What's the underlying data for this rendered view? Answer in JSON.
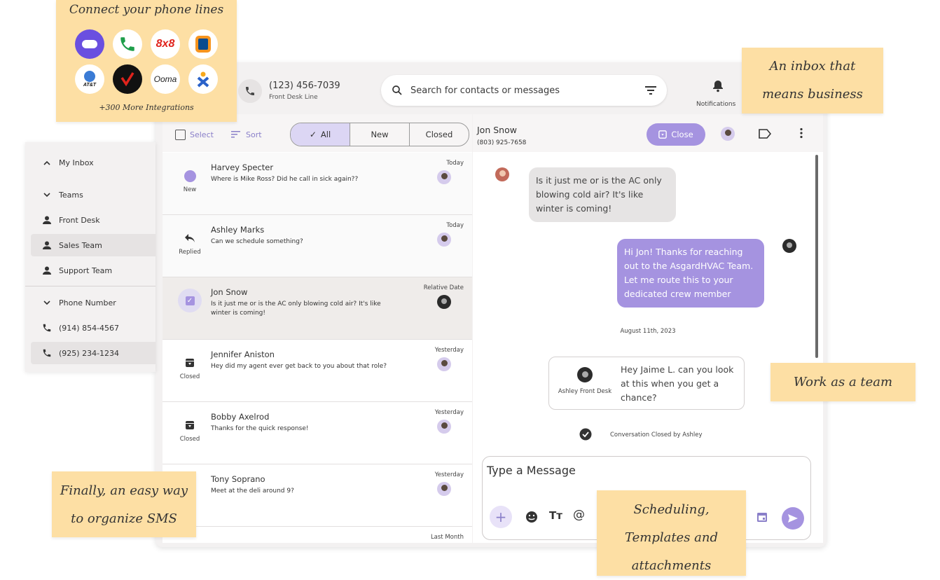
{
  "topbar": {
    "line_number": "(123) 456-7039",
    "line_label": "Front Desk Line",
    "search_placeholder": "Search for contacts or messages",
    "notifications_label": "Notifications"
  },
  "sidebar": {
    "my_inbox": "My Inbox",
    "teams": "Teams",
    "front_desk": "Front Desk",
    "sales_team": "Sales Team",
    "support_team": "Support Team",
    "phone_number": "Phone Number",
    "phone_1": "(914) 854-4567",
    "phone_2": "(925) 234-1234"
  },
  "list_toolbar": {
    "select": "Select",
    "sort": "Sort",
    "tabs": [
      "All",
      "New",
      "Closed"
    ]
  },
  "conversations": [
    {
      "name": "Harvey Specter",
      "preview": "Where is Mike Ross? Did he call in sick again??",
      "date": "Today",
      "status": "New"
    },
    {
      "name": "Ashley Marks",
      "preview": "Can we schedule something?",
      "date": "Today",
      "status": "Replied"
    },
    {
      "name": "Jon Snow",
      "preview": "Is it just me or is the AC only blowing cold air? It's like winter is coming!",
      "date": "Relative Date",
      "status": ""
    },
    {
      "name": "Jennifer Aniston",
      "preview": "Hey did my agent ever get back to you about that role?",
      "date": "Yesterday",
      "status": "Closed"
    },
    {
      "name": "Bobby Axelrod",
      "preview": "Thanks for the quick response!",
      "date": "Yesterday",
      "status": "Closed"
    },
    {
      "name": "Tony Soprano",
      "preview": "Meet at the deli around 9?",
      "date": "Yesterday",
      "status": ""
    },
    {
      "name": "",
      "preview": "",
      "date": "Last Month",
      "status": ""
    }
  ],
  "chat": {
    "contact_name": "Jon Snow",
    "contact_number": "(803) 925-7658",
    "close_label": "Close",
    "incoming": "Is it just me or is the AC only blowing cold air? It's like winter is coming!",
    "outgoing": "Hi Jon! Thanks for reaching out to the AsgardHVAC Team. Let me route this to your dedicated crew member",
    "date_separator": "August 11th, 2023",
    "note_text": "Hey Jaime L. can you look at this when you get a chance?",
    "note_author": "Ashley Front Desk",
    "closed_text": "Conversation Closed by Ashley",
    "composer_placeholder": "Type a Message"
  },
  "stickies": {
    "connect": "Connect your phone lines",
    "integrations": "+300 More Integrations",
    "inbox": [
      "An inbox that",
      "means business"
    ],
    "team": "Work as a team",
    "organize": [
      "Finally, an easy way",
      "to organize SMS"
    ],
    "scheduling": [
      "Scheduling,",
      "Templates and",
      "attachments"
    ]
  },
  "logos": [
    "8x8",
    "Ooma",
    "AT&T"
  ],
  "colors": {
    "accent": "#a593e0",
    "sticky": "#fddfa4",
    "panel": "#f3f1f1"
  }
}
